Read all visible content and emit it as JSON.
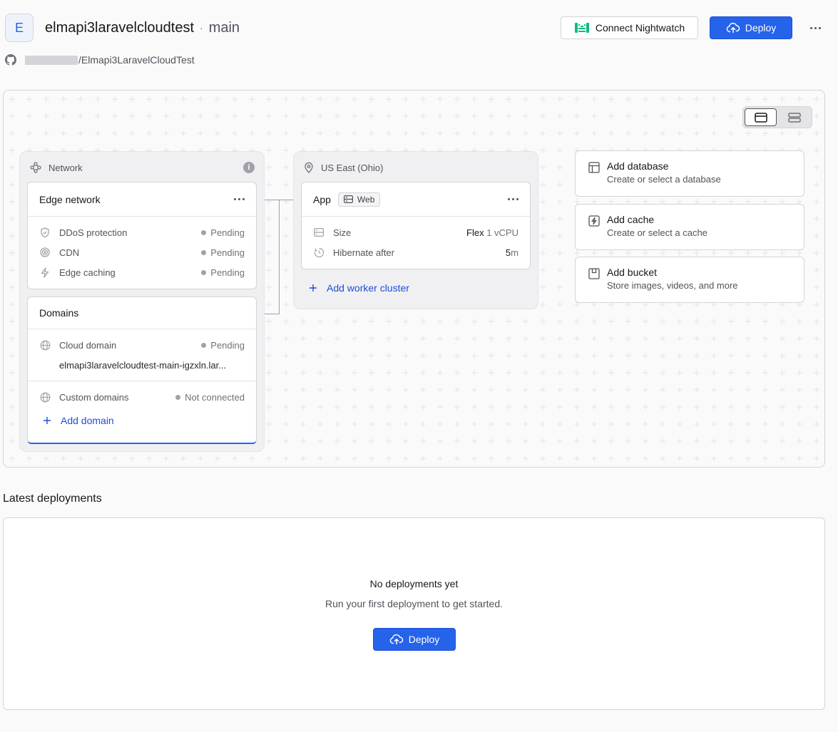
{
  "header": {
    "avatar_letter": "E",
    "project_name": "elmapi3laravelcloudtest",
    "separator": "·",
    "branch": "main",
    "nightwatch_label": "Connect Nightwatch",
    "deploy_label": "Deploy",
    "repo_path": "/Elmapi3LaravelCloudTest"
  },
  "network": {
    "title": "Network",
    "edge": {
      "title": "Edge network",
      "rows": [
        {
          "label": "DDoS protection",
          "status": "Pending",
          "icon": "shield-icon"
        },
        {
          "label": "CDN",
          "status": "Pending",
          "icon": "cdn-icon"
        },
        {
          "label": "Edge caching",
          "status": "Pending",
          "icon": "bolt-icon"
        }
      ]
    },
    "domains": {
      "title": "Domains",
      "cloud_label": "Cloud domain",
      "cloud_status": "Pending",
      "cloud_url": "elmapi3laravelcloudtest-main-igzxln.lar...",
      "custom_label": "Custom domains",
      "custom_status": "Not connected",
      "add_label": "Add domain"
    }
  },
  "region": {
    "title": "US East (Ohio)",
    "app": {
      "title": "App",
      "badge": "Web",
      "size_label": "Size",
      "size_value": "Flex",
      "size_unit": "1 vCPU",
      "hibernate_label": "Hibernate after",
      "hibernate_value": "5",
      "hibernate_unit": "m"
    },
    "add_worker_label": "Add worker cluster"
  },
  "resources": [
    {
      "title": "Add database",
      "subtitle": "Create or select a database",
      "icon": "database-icon"
    },
    {
      "title": "Add cache",
      "subtitle": "Create or select a cache",
      "icon": "cache-icon"
    },
    {
      "title": "Add bucket",
      "subtitle": "Store images, videos, and more",
      "icon": "bucket-icon"
    }
  ],
  "deployments": {
    "section_title": "Latest deployments",
    "empty_title": "No deployments yet",
    "empty_subtitle": "Run your first deployment to get started.",
    "deploy_label": "Deploy"
  },
  "colors": {
    "accent": "#2563eb",
    "nightwatch": "#10b981",
    "status_dot": "#a1a1aa"
  }
}
